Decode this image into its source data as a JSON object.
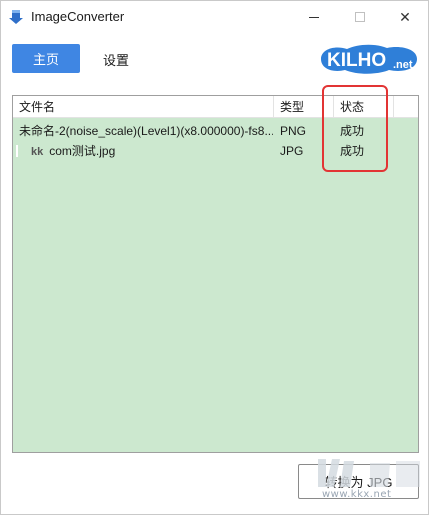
{
  "window": {
    "title": "ImageConverter",
    "minimize_label": "—",
    "close_label": "✕"
  },
  "nav": {
    "home_label": "主页",
    "settings_label": "设置"
  },
  "logo": {
    "text_main": "KILHO",
    "text_suffix": ".net"
  },
  "file_list": {
    "columns": [
      "文件名",
      "类型",
      "状态"
    ],
    "rows": [
      {
        "name": "未命名-2(noise_scale)(Level1)(x8.000000)-fs8....",
        "type": "PNG",
        "status": "成功"
      },
      {
        "prefix": "kk",
        "name": "com测试.jpg",
        "type": "JPG",
        "status": "成功"
      }
    ]
  },
  "actions": {
    "convert_label": "转换为 JPG"
  },
  "watermark": {
    "site": "www.kkx.net"
  },
  "colors": {
    "accent": "#3f86e3",
    "list_background": "#cce8cf",
    "highlight_border": "#e23434"
  }
}
